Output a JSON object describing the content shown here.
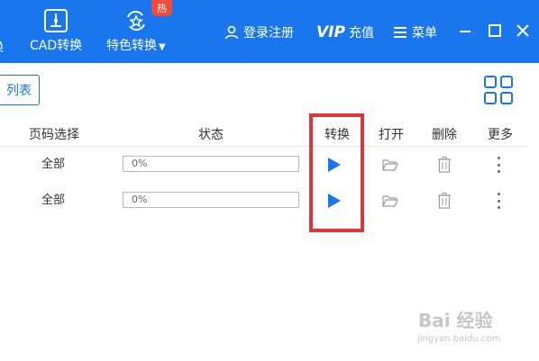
{
  "topbar": {
    "edge_label": "换",
    "cad_label": "CAD转换",
    "special_label": "特色转换",
    "hot_badge": "热",
    "login": "登录注册",
    "vip_logo": "VIP",
    "vip_recharge": "充值",
    "menu": "菜单"
  },
  "list_button": "列表",
  "table": {
    "headers": [
      "页码选择",
      "状态",
      "转换",
      "打开",
      "删除",
      "更多"
    ],
    "rows": [
      {
        "range": "全部",
        "progress": "0%"
      },
      {
        "range": "全部",
        "progress": "0%"
      }
    ]
  },
  "watermark": {
    "brand": "Bai 经验",
    "url": "jingyan.baidu.com"
  },
  "colors": {
    "accent": "#1a76ec",
    "highlight": "#e0363b"
  }
}
